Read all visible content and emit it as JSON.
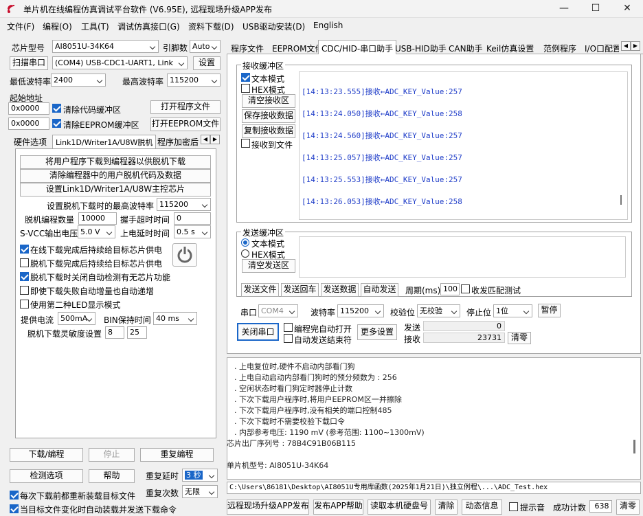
{
  "window": {
    "title": "单片机在线编程仿真调试平台软件 (V6.95E), 远程现场升级APP发布"
  },
  "menu": [
    "文件(F)",
    "编程(O)",
    "工具(T)",
    "调试仿真接口(G)",
    "资料下载(D)",
    "USB驱动安装(D)",
    "English"
  ],
  "left": {
    "chip_label": "芯片型号",
    "chip_value": "AI8051U-34K64",
    "pin_label": "引脚数",
    "pin_value": "Auto",
    "scan_label": "扫描串口",
    "port_value": "(COM4) USB-CDC1-UART1, Link",
    "settings": "设置",
    "min_baud_label": "最低波特率",
    "min_baud": "2400",
    "max_baud_label": "最高波特率",
    "max_baud": "115200",
    "start_addr": "起始地址",
    "addr1": "0x0000",
    "clear_code": "清除代码缓冲区",
    "open_prog": "打开程序文件",
    "addr2": "0x0000",
    "clear_eeprom": "清除EEPROM缓冲区",
    "open_eeprom": "打开EEPROM文件",
    "tabs": [
      "硬件选项",
      "Link1D/Writer1A/U8W脱机",
      "程序加密后"
    ],
    "offline_btns": [
      "将用户程序下载到编程器以供脱机下载",
      "清除编程器中的用户脱机代码及数据",
      "设置Link1D/Writer1A/U8W主控芯片"
    ],
    "max_baud_offline_label": "设置脱机下载时的最高波特率",
    "max_baud_offline": "115200",
    "offline_count_label": "脱机编程数量",
    "offline_count": "10000",
    "handshake_label": "握手超时时间",
    "handshake": "0",
    "svcc_label": "S-VCC输出电压",
    "svcc": "5.0 V",
    "power_delay_label": "上电延时时间",
    "power_delay": "0.5 s",
    "checks": [
      {
        "label": "在线下载完成后持续给目标芯片供电",
        "on": true
      },
      {
        "label": "脱机下载完成后持续给目标芯片供电",
        "on": false
      },
      {
        "label": "脱机下载时关闭自动检测有无芯片功能",
        "on": true
      },
      {
        "label": "即使下载失败自动增量也自动递增",
        "on": false
      },
      {
        "label": "使用第二种LED显示模式",
        "on": false
      }
    ],
    "current_label": "提供电流",
    "current": "500mA",
    "bin_label": "BIN保持时间",
    "bin": "40 ms",
    "sensitivity_label": "脱机下载灵敏度设置",
    "sens1": "8",
    "sens2": "25",
    "download": "下载/编程",
    "stop": "停止",
    "reprogram": "重复编程",
    "detect": "检测选项",
    "help": "帮助",
    "repeat_delay_label": "重复延时",
    "repeat_delay": "3 秒",
    "repeat_count_label": "重复次数",
    "repeat_count": "无限",
    "reload_each": "每次下载前都重新装载目标文件",
    "auto_send": "当目标文件变化时自动装载并发送下载命令"
  },
  "right_tabs": [
    "程序文件",
    "EEPROM文件",
    "CDC/HID-串口助手",
    "USB-HID助手",
    "CAN助手",
    "Keil仿真设置",
    "范例程序",
    "I/O口配置"
  ],
  "recv": {
    "title": "接收缓冲区",
    "text_mode": "文本模式",
    "hex_mode": "HEX模式",
    "clear": "清空接收区",
    "save": "保存接收数据",
    "copy": "复制接收数据",
    "to_file": "接收到文件",
    "lines": [
      "[14:13:23.555]接收←ADC_KEY_Value:257",
      "[14:13:24.050]接收←ADC_KEY_Value:258",
      "[14:13:24.560]接收←ADC_KEY_Value:257",
      "[14:13:25.057]接收←ADC_KEY_Value:257",
      "[14:13:25.553]接收←ADC_KEY_Value:257",
      "[14:13:26.053]接收←ADC_KEY_Value:258"
    ]
  },
  "send": {
    "title": "发送缓冲区",
    "text_mode": "文本模式",
    "hex_mode": "HEX模式",
    "clear": "清空发送区",
    "send_file": "发送文件",
    "send_enter": "发送回车",
    "send_data": "发送数据",
    "auto_send": "自动发送",
    "period_label": "周期(ms)",
    "period": "100",
    "match": "收发匹配测试"
  },
  "serial": {
    "port_label": "串口",
    "port": "COM4",
    "baud_label": "波特率",
    "baud": "115200",
    "parity_label": "校验位",
    "parity": "无校验",
    "stop_label": "停止位",
    "stop": "1位",
    "pause": "暂停",
    "close": "关闭串口",
    "auto_open": "编程完自动打开",
    "auto_end": "自动发送结束符",
    "more": "更多设置",
    "send_label": "发送",
    "send_count": "0",
    "recv_label": "接收",
    "recv_count": "23731",
    "clear": "清零"
  },
  "log": [
    "上电复位时,硬件不启动内部看门狗",
    "上电自动启动内部看门狗时的预分频数为 : 256",
    "空闲状态时看门狗定时器停止计数",
    "下次下载用户程序时,将用户EEPROM区一并擦除",
    "下次下载用户程序时,没有相关的端口控制485",
    "下次下载时不需要校验下载口令",
    "内部参考电压: 1190 mV (参考范围: 1100~1300mV)",
    "芯片出厂序列号 : 78B4C91B06B115",
    "",
    "单片机型号: AI8051U-34K64"
  ],
  "path": "C:\\Users\\86181\\Desktop\\AI8051U专用库函数(2025年1月21日)\\独立例程\\...\\ADC_Test.hex",
  "bottom": {
    "publish": "远程现场升级APP发布",
    "publish_help": "发布APP帮助",
    "read_disk": "读取本机硬盘号",
    "clear": "清除",
    "dynamic": "动态信息",
    "beep": "提示音",
    "success_label": "成功计数",
    "success": "638",
    "zero": "清零"
  }
}
